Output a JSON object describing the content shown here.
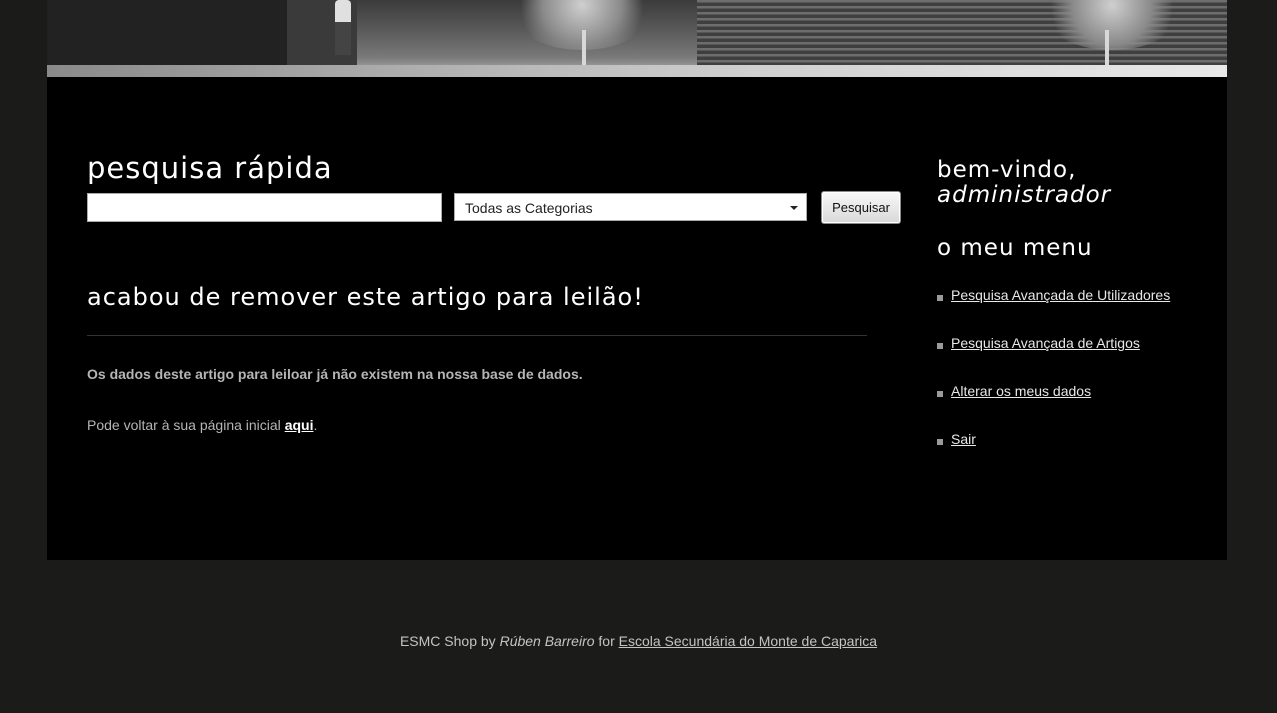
{
  "search": {
    "title": "pesquisa rápida",
    "input_value": "",
    "category_selected": "Todas as Categorias",
    "button_label": "Pesquisar"
  },
  "message": {
    "title": "acabou de remover este artigo para leilão!",
    "bold_text": "Os dados deste artigo para leiloar já não existem na nossa base de dados.",
    "back_text": "Pode voltar à sua página inicial ",
    "back_link": "aqui",
    "back_end": "."
  },
  "sidebar": {
    "welcome": "bem-vindo,",
    "username": "administrador",
    "menu_title": "o meu menu",
    "items": [
      {
        "label": "Pesquisa Avançada de Utilizadores"
      },
      {
        "label": "Pesquisa Avançada de Artigos"
      },
      {
        "label": "Alterar os meus dados"
      },
      {
        "label": "Sair"
      }
    ]
  },
  "footer": {
    "shop": "ESMC Shop by ",
    "author": "Rúben Barreiro",
    "for_text": " for ",
    "school": "Escola Secundária do Monte de Caparica"
  },
  "colors": {
    "page_bg": "#1b1b1a",
    "content_bg": "#000000",
    "heading": "#ffffff",
    "text": "#b5b5b5"
  }
}
